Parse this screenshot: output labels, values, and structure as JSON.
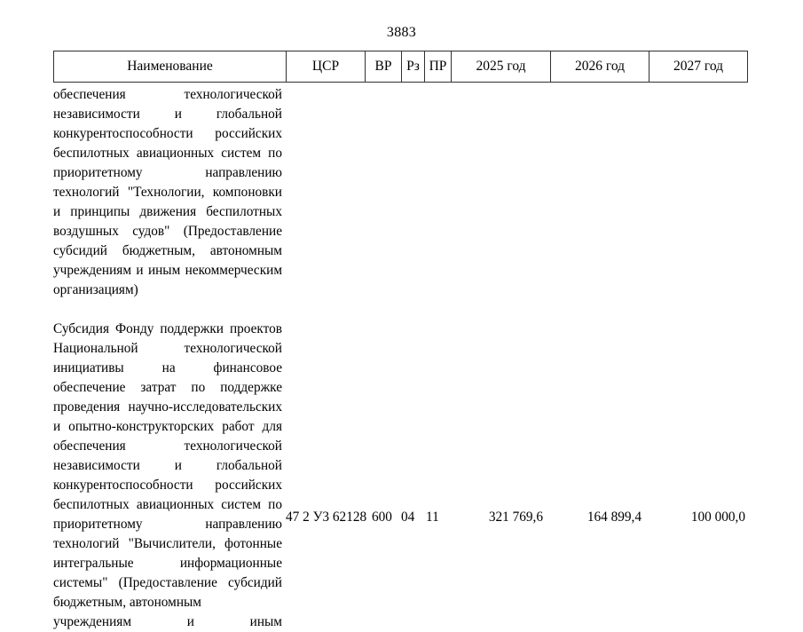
{
  "document": {
    "page_number": "3883"
  },
  "table": {
    "headers": {
      "name": "Наименование",
      "csr": "ЦСР",
      "vr": "ВР",
      "rz": "Рз",
      "pr": "ПР",
      "year1": "2025 год",
      "year2": "2026 год",
      "year3": "2027 год"
    },
    "paragraphs": [
      "обеспечения технологической независимости и глобальной конкурентоспособности российских беспилотных авиационных систем по приоритетному направлению технологий \"Технологии, компоновки и принципы движения беспилотных воздушных судов\" (Предоставление субсидий бюджетным, автономным учреждениям и иным некоммерческим организациям)",
      "Субсидия Фонду поддержки проектов Национальной технологической инициативы на финансовое обеспечение затрат по поддержке проведения научно-исследовательских и опытно-конструкторских работ для обеспечения технологической независимости и глобальной конкурентоспособности российских беспилотных авиационных систем по приоритетному направлению технологий \"Вычислители, фотонные интегральные информационные системы\" (Предоставление субсидий бюджетным, автономным"
    ],
    "last_line": "учреждениям и иным",
    "data_row": {
      "csr": "47 2 У3 62128",
      "vr": "600",
      "rz": "04",
      "pr": "11",
      "year1_value": "321 769,6",
      "year2_value": "164 899,4",
      "year3_value": "100 000,0"
    }
  }
}
